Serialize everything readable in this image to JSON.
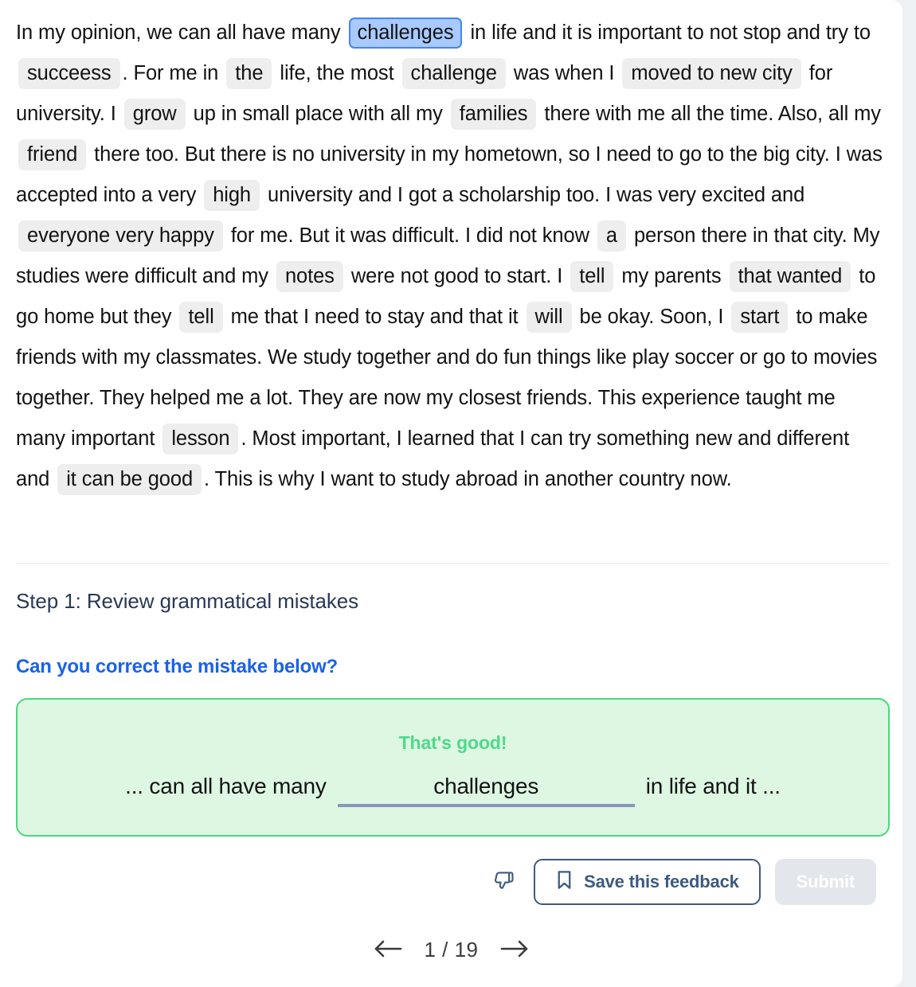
{
  "essay": {
    "segments": [
      {
        "t": "text",
        "v": "In my opinion, we can all have many "
      },
      {
        "t": "chip",
        "v": "challenges",
        "active": true
      },
      {
        "t": "text",
        "v": " in life and it is important to not stop and try to "
      },
      {
        "t": "chip",
        "v": "succeess",
        "active": false
      },
      {
        "t": "text",
        "v": ". For me in "
      },
      {
        "t": "chip",
        "v": "the",
        "active": false
      },
      {
        "t": "text",
        "v": " life, the most "
      },
      {
        "t": "chip",
        "v": "challenge",
        "active": false
      },
      {
        "t": "text",
        "v": " was when I "
      },
      {
        "t": "chip",
        "v": "moved to new city",
        "active": false
      },
      {
        "t": "text",
        "v": " for university. I "
      },
      {
        "t": "chip",
        "v": "grow",
        "active": false
      },
      {
        "t": "text",
        "v": " up in small place with all my "
      },
      {
        "t": "chip",
        "v": "families",
        "active": false
      },
      {
        "t": "text",
        "v": " there with me all the time. Also, all my "
      },
      {
        "t": "chip",
        "v": "friend",
        "active": false
      },
      {
        "t": "text",
        "v": " there too. But there is no university in my hometown, so I need to go to the big city. I was accepted into a very "
      },
      {
        "t": "chip",
        "v": "high",
        "active": false
      },
      {
        "t": "text",
        "v": " university and I got a scholarship too. I was very excited and "
      },
      {
        "t": "chip",
        "v": "everyone very happy",
        "active": false
      },
      {
        "t": "text",
        "v": " for me. But it was difficult. I did not know "
      },
      {
        "t": "chip",
        "v": "a",
        "active": false
      },
      {
        "t": "text",
        "v": " person there in that city. My studies were difficult and my "
      },
      {
        "t": "chip",
        "v": "notes",
        "active": false
      },
      {
        "t": "text",
        "v": " were not good to start. I "
      },
      {
        "t": "chip",
        "v": "tell",
        "active": false
      },
      {
        "t": "text",
        "v": " my parents "
      },
      {
        "t": "chip",
        "v": "that wanted",
        "active": false
      },
      {
        "t": "text",
        "v": " to go home but they "
      },
      {
        "t": "chip",
        "v": "tell",
        "active": false
      },
      {
        "t": "text",
        "v": " me that I need to stay and that it "
      },
      {
        "t": "chip",
        "v": "will",
        "active": false
      },
      {
        "t": "text",
        "v": " be okay. Soon, I "
      },
      {
        "t": "chip",
        "v": "start",
        "active": false
      },
      {
        "t": "text",
        "v": " to make friends with my classmates. We study together and do fun things like play soccer or go to movies together. They helped me a lot. They are now my closest friends. This experience taught me many important "
      },
      {
        "t": "chip",
        "v": "lesson",
        "active": false
      },
      {
        "t": "text",
        "v": ". Most important, I learned that I can try something new and different and "
      },
      {
        "t": "chip",
        "v": "it can be good",
        "active": false
      },
      {
        "t": "text",
        "v": ". This is why I want to study abroad in another country now."
      }
    ]
  },
  "step": {
    "title": "Step 1: Review grammatical mistakes",
    "question": "Can you correct the mistake below?"
  },
  "feedback": {
    "status": "That's good!",
    "sentence_before": "... can all have many",
    "answer_value": "challenges",
    "answer_placeholder": "",
    "sentence_after": "in life and it ...",
    "box_fill": "#ddf7e3",
    "box_border": "#4bd87e",
    "status_color": "#4fd98a"
  },
  "actions": {
    "thumb_down_icon": "thumbs-down-icon",
    "save_icon": "bookmark-icon",
    "save_label": "Save this feedback",
    "submit_label": "Submit",
    "save_color": "#3d5a80",
    "submit_disabled_bg": "#e3e6eb"
  },
  "pager": {
    "prev_icon": "arrow-left-icon",
    "next_icon": "arrow-right-icon",
    "label": "1 / 19",
    "current": 1,
    "total": 19
  }
}
